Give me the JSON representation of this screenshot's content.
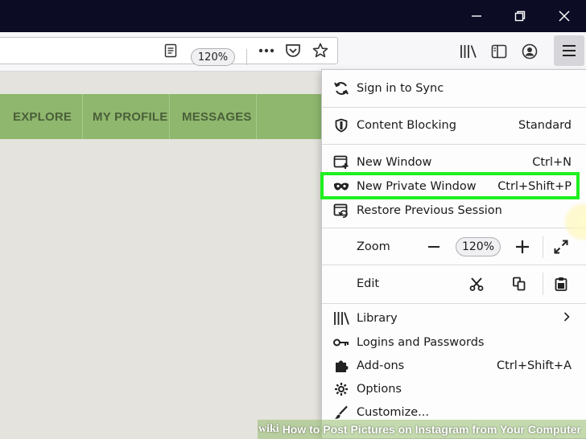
{
  "toolbar": {
    "zoom_level": "120%"
  },
  "site_nav": {
    "items": [
      {
        "label": "EXPLORE"
      },
      {
        "label": "MY PROFILE"
      },
      {
        "label": "MESSAGES"
      }
    ]
  },
  "menu": {
    "sign_in": "Sign in to Sync",
    "content_blocking": {
      "label": "Content Blocking",
      "value": "Standard"
    },
    "new_window": {
      "label": "New Window",
      "shortcut": "Ctrl+N"
    },
    "new_private_window": {
      "label": "New Private Window",
      "shortcut": "Ctrl+Shift+P"
    },
    "restore_session": "Restore Previous Session",
    "zoom": {
      "label": "Zoom",
      "value": "120%"
    },
    "edit": {
      "label": "Edit"
    },
    "library": "Library",
    "logins": "Logins and Passwords",
    "addons": {
      "label": "Add-ons",
      "shortcut": "Ctrl+Shift+A"
    },
    "options": "Options",
    "customize": "Customize..."
  },
  "watermark": {
    "brand": "wiki",
    "text": "How to Post Pictures on Instagram from Your Computer"
  },
  "colors": {
    "highlight": "#1ff01f",
    "nav_bg": "#8fb76d",
    "titlebar": "#0c0c25"
  }
}
